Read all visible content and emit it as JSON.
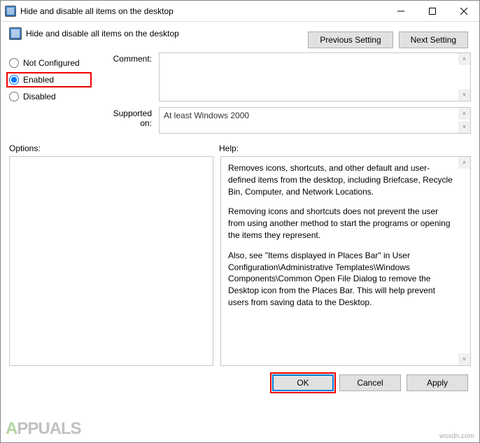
{
  "window": {
    "title": "Hide and disable all items on the desktop"
  },
  "header": {
    "policy_name": "Hide and disable all items on the desktop",
    "prev_button": "Previous Setting",
    "next_button": "Next Setting"
  },
  "state": {
    "not_configured": "Not Configured",
    "enabled": "Enabled",
    "disabled": "Disabled",
    "selected": "enabled"
  },
  "fields": {
    "comment_label": "Comment:",
    "comment_value": "",
    "supported_label": "Supported on:",
    "supported_value": "At least Windows 2000"
  },
  "panes": {
    "options_label": "Options:",
    "help_label": "Help:",
    "help_p1": "Removes icons, shortcuts, and other default and user-defined items from the desktop, including Briefcase, Recycle Bin, Computer, and Network Locations.",
    "help_p2": "Removing icons and shortcuts does not prevent the user from using another method to start the programs or opening the items they represent.",
    "help_p3": "Also, see \"Items displayed in Places Bar\" in User Configuration\\Administrative Templates\\Windows Components\\Common Open File Dialog to remove the Desktop icon from the Places Bar. This will help prevent users from saving data to the Desktop."
  },
  "buttons": {
    "ok": "OK",
    "cancel": "Cancel",
    "apply": "Apply"
  },
  "watermark": {
    "text1": "A",
    "text2": "PPUALS",
    "site": "wsxdn.com"
  }
}
